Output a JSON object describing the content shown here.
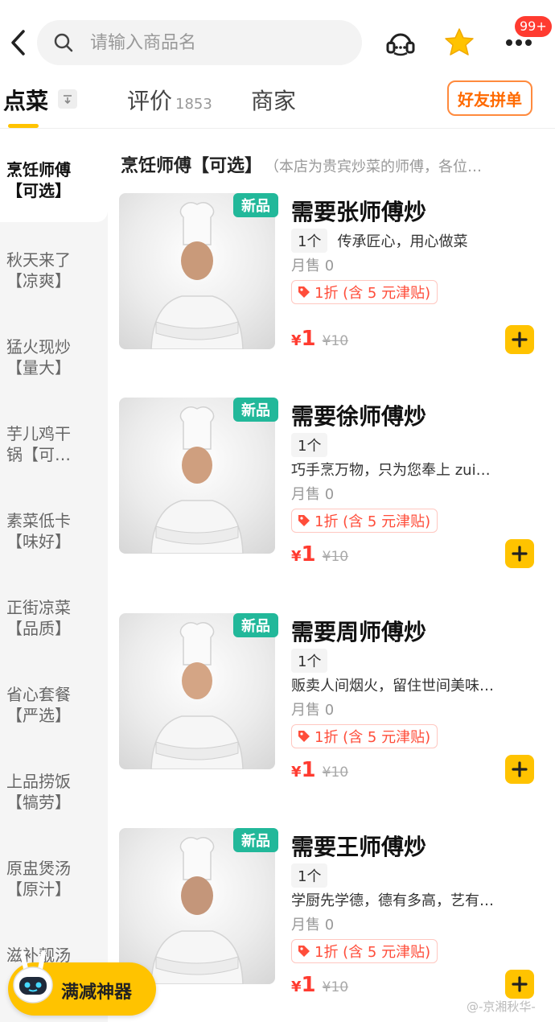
{
  "search": {
    "placeholder": "请输入商品名"
  },
  "header": {
    "badge": "99+"
  },
  "tabs": [
    {
      "label": "点菜",
      "count": ""
    },
    {
      "label": "评价",
      "count": "1853"
    },
    {
      "label": "商家",
      "count": ""
    }
  ],
  "friend_button": "好友拼单",
  "sidebar": [
    {
      "line1": "烹饪师傅",
      "line2": "【可选】"
    },
    {
      "line1": "秋天来了",
      "line2": "【凉爽】"
    },
    {
      "line1": "猛火现炒",
      "line2": "【量大】"
    },
    {
      "line1": "芋儿鸡干",
      "line2": "锅【可…"
    },
    {
      "line1": "素菜低卡",
      "line2": "【味好】"
    },
    {
      "line1": "正街凉菜",
      "line2": "【品质】"
    },
    {
      "line1": "省心套餐",
      "line2": "【严选】"
    },
    {
      "line1": "上品捞饭",
      "line2": "【犒劳】"
    },
    {
      "line1": "原盅煲汤",
      "line2": "【原汁】"
    },
    {
      "line1": "滋补靓汤",
      "line2": ""
    }
  ],
  "section": {
    "title": "烹饪师傅【可选】",
    "desc": "（本店为贵宾炒菜的师傅，各位…"
  },
  "products": [
    {
      "tag": "新品",
      "name": "需要张师傅炒",
      "unit": "1个",
      "desc": "传承匠心，用心做菜",
      "sold": "月售 0",
      "discount": "1折 (含 5 元津贴)",
      "currency": "¥",
      "price": "1",
      "old_price": "¥10"
    },
    {
      "tag": "新品",
      "name": "需要徐师傅炒",
      "unit": "1个",
      "desc": "巧手烹万物，只为您奉上 zui…",
      "sold": "月售 0",
      "discount": "1折 (含 5 元津贴)",
      "currency": "¥",
      "price": "1",
      "old_price": "¥10"
    },
    {
      "tag": "新品",
      "name": "需要周师傅炒",
      "unit": "1个",
      "desc": "贩卖人间烟火，留住世间美味…",
      "sold": "月售 0",
      "discount": "1折 (含 5 元津贴)",
      "currency": "¥",
      "price": "1",
      "old_price": "¥10"
    },
    {
      "tag": "新品",
      "name": "需要王师傅炒",
      "unit": "1个",
      "desc": "学厨先学德，德有多高，艺有…",
      "sold": "月售 0",
      "discount": "1折 (含 5 元津贴)",
      "currency": "¥",
      "price": "1",
      "old_price": "¥10"
    }
  ],
  "promo": {
    "label": "满减神器"
  },
  "watermark": "@-京湘秋华-",
  "colors": {
    "accent": "#ffc300",
    "price": "#ff3b30",
    "new_tag": "#22b89a",
    "friend_border": "#ff8a3d"
  }
}
